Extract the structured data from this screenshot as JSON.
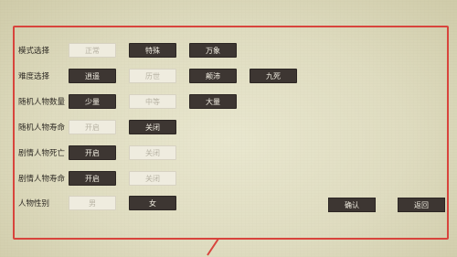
{
  "rows": [
    {
      "label": "模式选择",
      "options": [
        {
          "text": "正常",
          "selected": false
        },
        {
          "text": "特殊",
          "selected": true
        },
        {
          "text": "万象",
          "selected": true
        }
      ]
    },
    {
      "label": "难度选择",
      "options": [
        {
          "text": "逍遥",
          "selected": true
        },
        {
          "text": "历世",
          "selected": false
        },
        {
          "text": "颠沛",
          "selected": true
        },
        {
          "text": "九死",
          "selected": true
        }
      ]
    },
    {
      "label": "随机人物数量",
      "options": [
        {
          "text": "少量",
          "selected": true
        },
        {
          "text": "中等",
          "selected": false
        },
        {
          "text": "大量",
          "selected": true
        }
      ]
    },
    {
      "label": "随机人物寿命",
      "options": [
        {
          "text": "开启",
          "selected": false
        },
        {
          "text": "关闭",
          "selected": true
        }
      ]
    },
    {
      "label": "剧情人物死亡",
      "options": [
        {
          "text": "开启",
          "selected": true
        },
        {
          "text": "关闭",
          "selected": false
        }
      ]
    },
    {
      "label": "剧情人物寿命",
      "options": [
        {
          "text": "开启",
          "selected": true
        },
        {
          "text": "关闭",
          "selected": false
        }
      ]
    },
    {
      "label": "人物性别",
      "options": [
        {
          "text": "男",
          "selected": false
        },
        {
          "text": "女",
          "selected": true
        }
      ]
    }
  ],
  "actions": {
    "confirm": "确认",
    "back": "返回"
  },
  "colors": {
    "frame": "#d8443c",
    "dark_button": "#3d3632",
    "light_button": "#efecdf"
  }
}
